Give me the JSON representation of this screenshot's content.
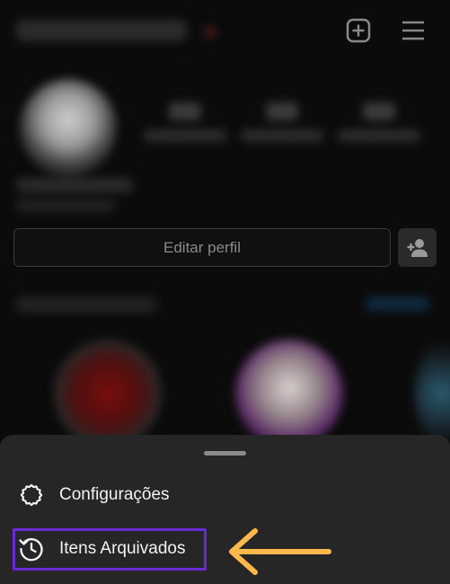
{
  "profile": {
    "edit_profile_label": "Editar perfil"
  },
  "icons": {
    "new_post": "plus-square-icon",
    "menu": "hamburger-menu-icon",
    "add_user": "add-user-icon",
    "settings": "gear-icon",
    "archive": "history-icon",
    "annotation_arrow": "left-arrow-icon"
  },
  "menu": {
    "items": [
      {
        "label": "Configurações",
        "icon": "gear-icon"
      },
      {
        "label": "Itens Arquivados",
        "icon": "history-icon"
      }
    ]
  },
  "colors": {
    "sheet_background": "#262626",
    "highlight_box": "#6a2ad6",
    "arrow": "#ffb84a"
  }
}
